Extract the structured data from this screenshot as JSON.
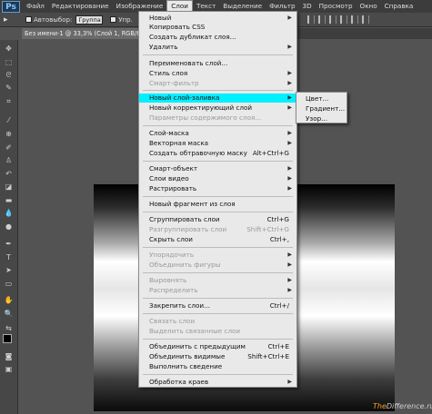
{
  "app": {
    "logo": "Ps"
  },
  "menubar": {
    "items": [
      "Файл",
      "Редактирование",
      "Изображение",
      "Слои",
      "Текст",
      "Выделение",
      "Фильтр",
      "3D",
      "Просмотр",
      "Окно",
      "Справка"
    ],
    "active_index": 3
  },
  "options_bar": {
    "tool_glyph": "▸",
    "autoselect_label": "Автовыбор:",
    "autoselect_value": "Группа",
    "transform_label": "Упр."
  },
  "document": {
    "tab_title": "Без имени-1 @ 33,3% (Слой 1, RGB/8) *",
    "close_glyph": "×"
  },
  "layer_menu": {
    "items": [
      {
        "label": "Новый",
        "submenu": true
      },
      {
        "label": "Копировать CSS"
      },
      {
        "label": "Создать дубликат слоя..."
      },
      {
        "label": "Удалить",
        "submenu": true
      },
      {
        "label": "Переименовать слой..."
      },
      {
        "label": "Стиль слоя",
        "submenu": true
      },
      {
        "label": "Смарт-фильтр",
        "submenu": true,
        "disabled": true
      },
      {
        "label": "Новый слой-заливка",
        "submenu": true,
        "highlighted": true
      },
      {
        "label": "Новый корректирующий слой",
        "submenu": true
      },
      {
        "label": "Параметры содержимого слоя...",
        "disabled": true
      },
      {
        "label": "Слой-маска",
        "submenu": true
      },
      {
        "label": "Векторная маска",
        "submenu": true
      },
      {
        "label": "Создать обтравочную маску",
        "shortcut": "Alt+Ctrl+G"
      },
      {
        "label": "Смарт-объект",
        "submenu": true
      },
      {
        "label": "Слои видео",
        "submenu": true
      },
      {
        "label": "Растрировать",
        "submenu": true
      },
      {
        "label": "Новый фрагмент из слоя"
      },
      {
        "label": "Сгруппировать слои",
        "shortcut": "Ctrl+G"
      },
      {
        "label": "Разгруппировать слои",
        "shortcut": "Shift+Ctrl+G",
        "disabled": true
      },
      {
        "label": "Скрыть слои",
        "shortcut": "Ctrl+,"
      },
      {
        "label": "Упорядочить",
        "submenu": true,
        "disabled": true
      },
      {
        "label": "Объединить фигуры",
        "submenu": true,
        "disabled": true
      },
      {
        "label": "Выровнять",
        "submenu": true,
        "disabled": true
      },
      {
        "label": "Распределить",
        "submenu": true,
        "disabled": true
      },
      {
        "label": "Закрепить слои...",
        "shortcut": "Ctrl+/"
      },
      {
        "label": "Связать слои",
        "disabled": true
      },
      {
        "label": "Выделить связанные слои",
        "disabled": true
      },
      {
        "label": "Объединить с предыдущим",
        "shortcut": "Ctrl+E"
      },
      {
        "label": "Объединить видимые",
        "shortcut": "Shift+Ctrl+E"
      },
      {
        "label": "Выполнить сведение"
      },
      {
        "label": "Обработка краев",
        "submenu": true
      }
    ]
  },
  "fill_submenu": {
    "items": [
      "Цвет...",
      "Градиент...",
      "Узор..."
    ]
  },
  "watermark": {
    "part1": "The",
    "part2": "Difference.ru"
  },
  "colors": {
    "highlight": "#00f0ff",
    "menu_bg": "#e9e9e9"
  }
}
